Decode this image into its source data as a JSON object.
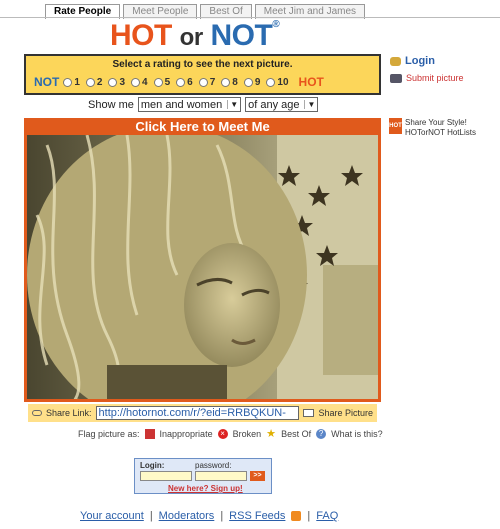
{
  "tabs": [
    "Rate People",
    "Meet People",
    "Best Of",
    "Meet Jim and James"
  ],
  "logo": {
    "hot": "HOT",
    "or": "or",
    "not": "NOT"
  },
  "rating": {
    "title": "Select a rating to see the next picture.",
    "not_label": "NOT",
    "hot_label": "HOT",
    "options": [
      "1",
      "2",
      "3",
      "4",
      "5",
      "6",
      "7",
      "8",
      "9",
      "10"
    ]
  },
  "side": {
    "login": "Login",
    "submit": "Submit picture",
    "share_style": "Share Your Style!",
    "hotlists": "HOTorNOT HotLists"
  },
  "filter": {
    "label": "Show me",
    "gender": "men and women",
    "age": "of any age"
  },
  "meet_banner": "Click Here to Meet Me",
  "share": {
    "label": "Share Link:",
    "url": "http://hotornot.com/r/?eid=RRBQKUN-",
    "picture": "Share Picture"
  },
  "flag": {
    "label": "Flag picture as:",
    "inappropriate": "Inappropriate",
    "broken": "Broken",
    "best_of": "Best Of",
    "what": "What is this?"
  },
  "login_box": {
    "login_label": "Login:",
    "password_label": "password:",
    "go": ">>",
    "signup": "New here? Sign up!"
  },
  "footer": {
    "account": "Your account",
    "moderators": "Moderators",
    "rss": "RSS Feeds",
    "faq": "FAQ",
    "sep": "|"
  }
}
